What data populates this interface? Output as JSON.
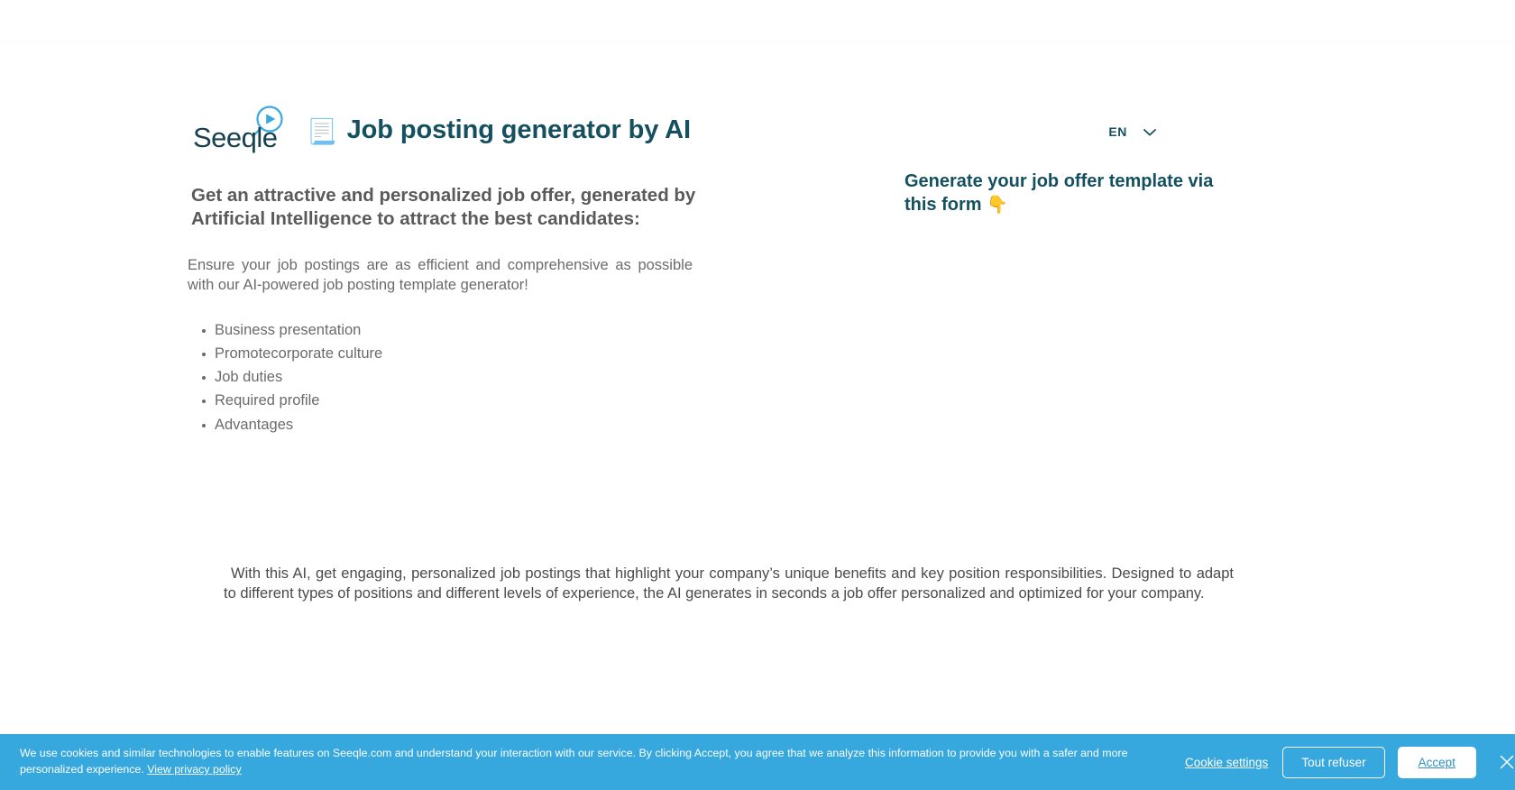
{
  "header": {
    "logo_text": "Seeqle",
    "logo_icon": "play-magnifier-icon",
    "title_emoji": "📃",
    "title": "Job posting generator by AI",
    "language": {
      "code": "EN",
      "chevron_icon": "chevron-down-icon"
    }
  },
  "left_column": {
    "lead_heading": "Get an attractive and personalized job offer, generated by Artificial Intelligence to attract the best candidates:",
    "lead_paragraph": "Ensure your job postings are as efficient and comprehensive as possible with our AI-powered job posting template generator!",
    "features": [
      "Business presentation",
      "Promotecorporate culture",
      "Job duties",
      "Required profile",
      "Advantages"
    ]
  },
  "right_column": {
    "form_heading": "Generate your job offer template via this form",
    "form_heading_emoji": "👇"
  },
  "closing_paragraph": "With this AI, get engaging, personalized job postings that highlight your company’s unique benefits and key position responsibilities. Designed to adapt to different types of positions and different levels of experience, the AI generates in seconds a job offer personalized and optimized for your company.",
  "cookie_banner": {
    "message": "We use cookies and similar technologies to enable features on Seeqle.com and understand your interaction with our service. By clicking Accept, you agree that we analyze this information to provide you with a safer and more personalized experience. ",
    "privacy_link": "View privacy policy",
    "settings_label": "Cookie settings",
    "refuse_label": "Tout refuser",
    "accept_label": "Accept",
    "close_icon": "close-icon",
    "background_color": "#36a8de"
  },
  "colors": {
    "brand_dark": "#14505f",
    "brand_blue": "#36a8de",
    "body_text": "#6b6b6b",
    "accent_yellow": "#f5c02c"
  }
}
